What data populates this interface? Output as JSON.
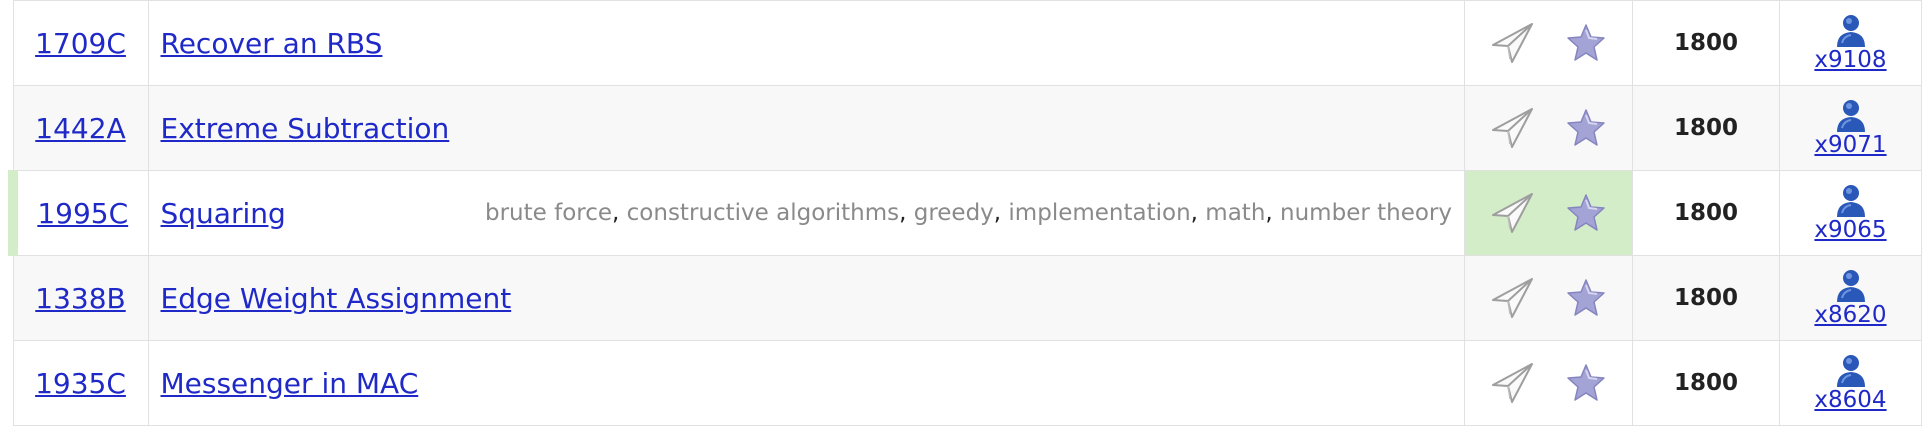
{
  "problems": [
    {
      "id": "1709C",
      "name": "Recover an RBS",
      "tags": [],
      "rating": "1800",
      "solved": "x9108",
      "accepted": false
    },
    {
      "id": "1442A",
      "name": "Extreme Subtraction",
      "tags": [],
      "rating": "1800",
      "solved": "x9071",
      "accepted": false
    },
    {
      "id": "1995C",
      "name": "Squaring",
      "tags": [
        "brute force",
        "constructive algorithms",
        "greedy",
        "implementation",
        "math",
        "number theory"
      ],
      "rating": "1800",
      "solved": "x9065",
      "accepted": true
    },
    {
      "id": "1338B",
      "name": "Edge Weight Assignment",
      "tags": [],
      "rating": "1800",
      "solved": "x8620",
      "accepted": false
    },
    {
      "id": "1935C",
      "name": "Messenger in MAC",
      "tags": [],
      "rating": "1800",
      "solved": "x8604",
      "accepted": false
    }
  ],
  "icons": {
    "submit": "paper-plane-icon",
    "favourite": "star-icon",
    "solved_by": "user-icon"
  },
  "colors": {
    "link": "#1f29c8",
    "accepted_bg": "#d4edc9",
    "tag": "#8a8a8a",
    "star": "#9a9ad0"
  }
}
